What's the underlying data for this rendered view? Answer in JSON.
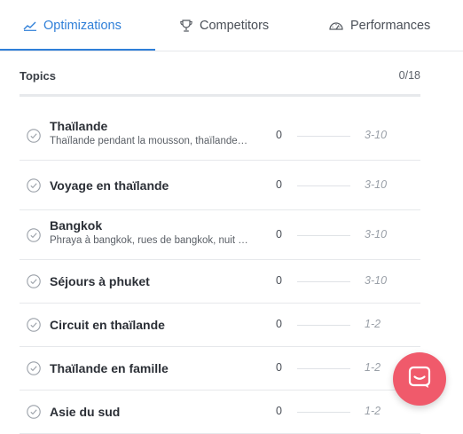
{
  "tabs": [
    {
      "label": "Optimizations",
      "icon": "trend-line-icon",
      "active": true
    },
    {
      "label": "Competitors",
      "icon": "trophy-icon",
      "active": false
    },
    {
      "label": "Performances",
      "icon": "gauge-icon",
      "active": false
    }
  ],
  "topics": {
    "title": "Topics",
    "count": "0/18",
    "progress": 0,
    "items": [
      {
        "title": "Thaïlande",
        "subtitle": "Thaïlande pendant la mousson, thaïlande…",
        "count": "0",
        "range": "3-10"
      },
      {
        "title": "Voyage en thaïlande",
        "subtitle": "",
        "count": "0",
        "range": "3-10"
      },
      {
        "title": "Bangkok",
        "subtitle": "Phraya à bangkok, rues de bangkok, nuit …",
        "count": "0",
        "range": "3-10"
      },
      {
        "title": "Séjours à phuket",
        "subtitle": "",
        "count": "0",
        "range": "3-10"
      },
      {
        "title": "Circuit en thaïlande",
        "subtitle": "",
        "count": "0",
        "range": "1-2"
      },
      {
        "title": "Thaïlande en famille",
        "subtitle": "",
        "count": "0",
        "range": "1-2"
      },
      {
        "title": "Asie du sud",
        "subtitle": "",
        "count": "0",
        "range": "1-2"
      }
    ]
  },
  "colors": {
    "accent": "#2f7fd8",
    "chat_button": "#f05a6b"
  },
  "chat": {
    "icon": "chat-bubble-icon"
  }
}
